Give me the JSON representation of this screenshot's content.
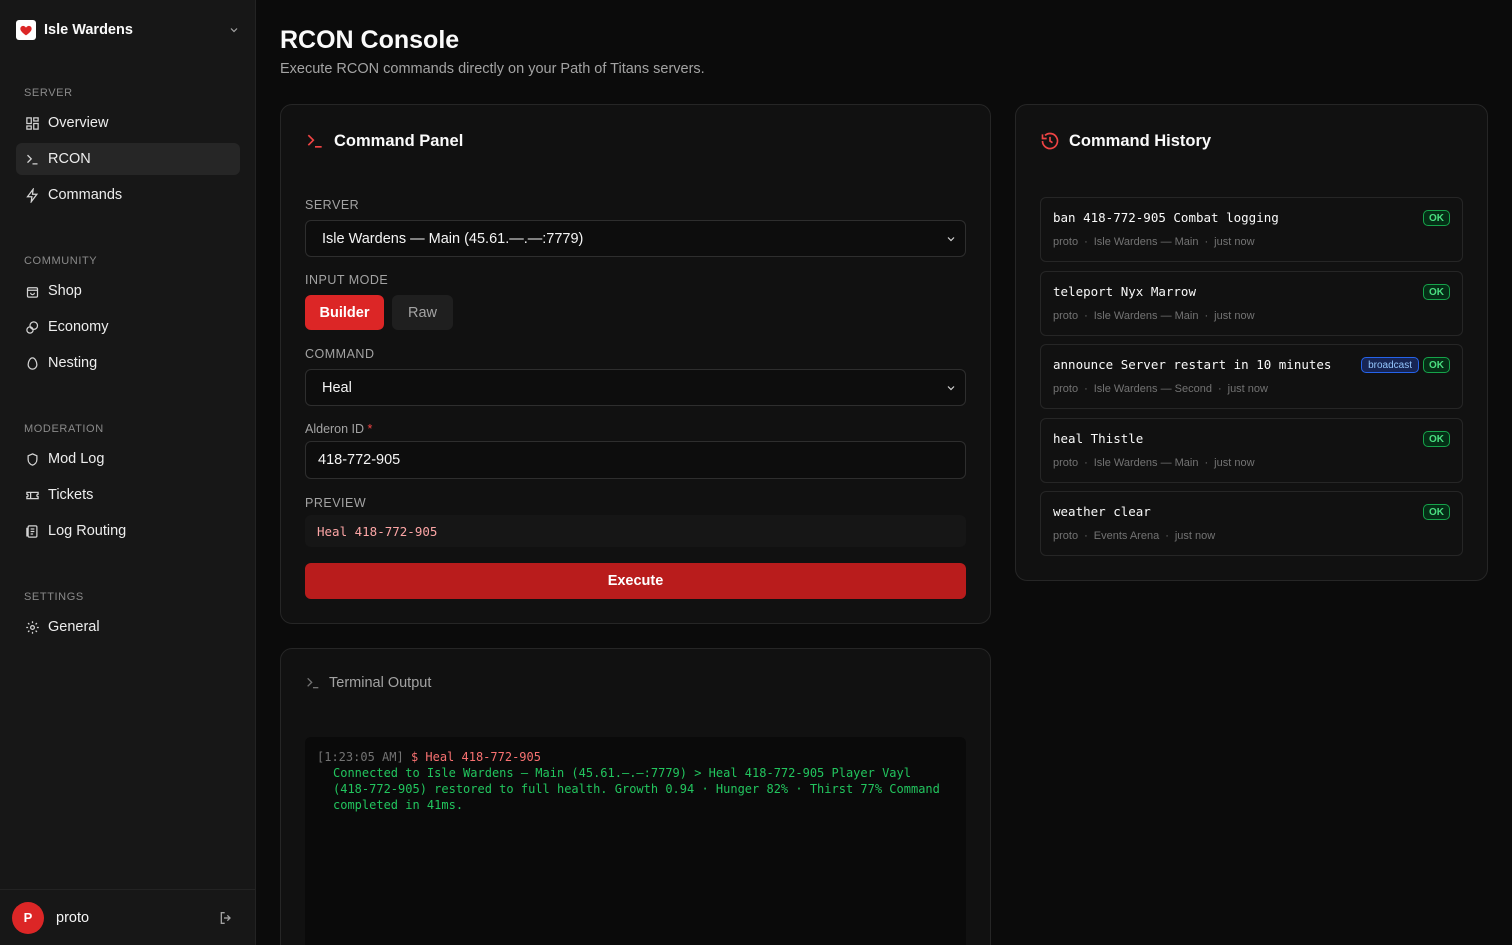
{
  "brand": {
    "name": "Isle Wardens"
  },
  "sidebar": {
    "sections": [
      {
        "heading": "SERVER",
        "items": [
          {
            "label": "Overview",
            "icon": "grid-icon"
          },
          {
            "label": "RCON",
            "icon": "terminal-icon",
            "active": true
          },
          {
            "label": "Commands",
            "icon": "bolt-icon"
          }
        ]
      },
      {
        "heading": "COMMUNITY",
        "items": [
          {
            "label": "Shop",
            "icon": "bag-icon"
          },
          {
            "label": "Economy",
            "icon": "coins-icon"
          },
          {
            "label": "Nesting",
            "icon": "egg-icon"
          }
        ]
      },
      {
        "heading": "MODERATION",
        "items": [
          {
            "label": "Mod Log",
            "icon": "shield-icon"
          },
          {
            "label": "Tickets",
            "icon": "ticket-icon"
          },
          {
            "label": "Log Routing",
            "icon": "log-icon"
          }
        ]
      },
      {
        "heading": "SETTINGS",
        "items": [
          {
            "label": "General",
            "icon": "gear-icon"
          }
        ]
      }
    ]
  },
  "user": {
    "initial": "P",
    "name": "proto"
  },
  "page": {
    "title": "RCON Console",
    "subtitle": "Execute RCON commands directly on your Path of Titans servers."
  },
  "command_panel": {
    "title": "Command Panel",
    "server_label": "SERVER",
    "server_value": "Isle Wardens — Main (45.61.—.—:7779)",
    "input_mode_label": "INPUT MODE",
    "mode_builder": "Builder",
    "mode_raw": "Raw",
    "command_label": "COMMAND",
    "command_value": "Heal",
    "alderon_label": "Alderon ID",
    "required_mark": "*",
    "alderon_value": "418-772-905",
    "preview_label": "PREVIEW",
    "preview_value": "Heal 418-772-905",
    "execute_label": "Execute"
  },
  "terminal": {
    "title": "Terminal Output",
    "entries": [
      {
        "timestamp": "[1:23:05 AM]",
        "command": "$ Heal 418-772-905",
        "output": "Connected to Isle Wardens — Main (45.61.—.—:7779) > Heal 418-772-905 Player Vayl (418-772-905) restored to full health. Growth 0.94 · Hunger 82% · Thirst 77% Command completed in 41ms."
      }
    ]
  },
  "history": {
    "title": "Command History",
    "items": [
      {
        "command": "ban 418-772-905 Combat logging",
        "user": "proto",
        "server": "Isle Wardens — Main",
        "time": "just now",
        "status": "OK",
        "tag": ""
      },
      {
        "command": "teleport Nyx Marrow",
        "user": "proto",
        "server": "Isle Wardens — Main",
        "time": "just now",
        "status": "OK",
        "tag": ""
      },
      {
        "command": "announce Server restart in 10 minutes",
        "user": "proto",
        "server": "Isle Wardens — Second",
        "time": "just now",
        "status": "OK",
        "tag": "broadcast"
      },
      {
        "command": "heal Thistle",
        "user": "proto",
        "server": "Isle Wardens — Main",
        "time": "just now",
        "status": "OK",
        "tag": ""
      },
      {
        "command": "weather clear",
        "user": "proto",
        "server": "Events Arena",
        "time": "just now",
        "status": "OK",
        "tag": ""
      }
    ],
    "meta_separator": "·"
  },
  "colors": {
    "accent": "#dc2626",
    "ok": "#4ade80",
    "broadcast": "#93c5fd"
  }
}
